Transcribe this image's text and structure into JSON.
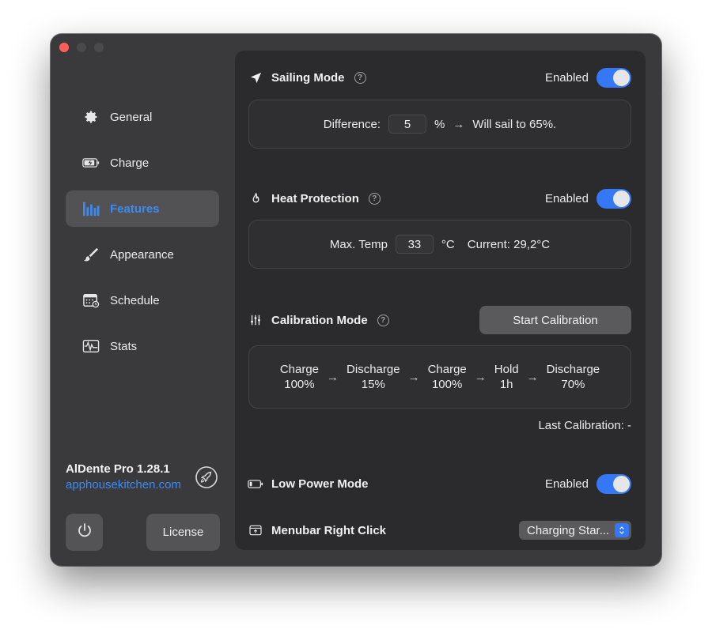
{
  "sidebar": {
    "items": [
      {
        "label": "General",
        "icon": "gear-icon"
      },
      {
        "label": "Charge",
        "icon": "battery-charging-icon"
      },
      {
        "label": "Features",
        "icon": "features-bars-icon",
        "active": true
      },
      {
        "label": "Appearance",
        "icon": "paintbrush-icon"
      },
      {
        "label": "Schedule",
        "icon": "calendar-icon"
      },
      {
        "label": "Stats",
        "icon": "waveform-icon"
      }
    ],
    "app_name": "AlDente Pro 1.28.1",
    "app_link": "apphousekitchen.com",
    "license_label": "License"
  },
  "sailing": {
    "title": "Sailing Mode",
    "status": "Enabled",
    "difference_label": "Difference:",
    "difference_value": "5",
    "unit": "%",
    "result": "Will sail to 65%."
  },
  "heat": {
    "title": "Heat Protection",
    "status": "Enabled",
    "max_label": "Max. Temp",
    "max_value": "33",
    "unit": "°C",
    "current": "Current: 29,2°C"
  },
  "calibration": {
    "title": "Calibration Mode",
    "button": "Start Calibration",
    "steps": [
      {
        "line1": "Charge",
        "line2": "100%"
      },
      {
        "line1": "Discharge",
        "line2": "15%"
      },
      {
        "line1": "Charge",
        "line2": "100%"
      },
      {
        "line1": "Hold",
        "line2": "1h"
      },
      {
        "line1": "Discharge",
        "line2": "70%"
      }
    ],
    "last": "Last Calibration: -"
  },
  "low_power": {
    "title": "Low Power Mode",
    "status": "Enabled"
  },
  "menubar": {
    "title": "Menubar Right Click",
    "selected": "Charging Star..."
  },
  "colors": {
    "accent": "#3478f6",
    "link": "#3b8bf5",
    "close": "#ff5f57"
  }
}
